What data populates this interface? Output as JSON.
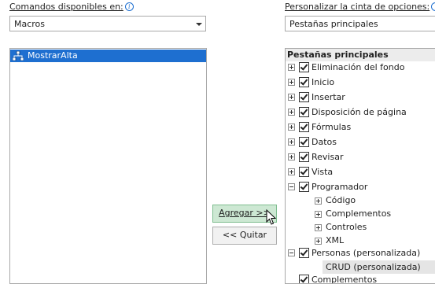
{
  "left": {
    "label": "Comandos disponibles en:",
    "dropdown_value": "Macros",
    "items": [
      {
        "label": "MostrarAlta",
        "selected": true,
        "icon": "macro-icon"
      }
    ]
  },
  "right": {
    "label": "Personalizar la cinta de opciones:",
    "dropdown_value": "Pestañas principales",
    "tree_header": "Pestañas principales",
    "tabs": [
      {
        "label": "Eliminación del fondo",
        "checked": true,
        "expanded": false
      },
      {
        "label": "Inicio",
        "checked": true,
        "expanded": false
      },
      {
        "label": "Insertar",
        "checked": true,
        "expanded": false
      },
      {
        "label": "Disposición de página",
        "checked": true,
        "expanded": false
      },
      {
        "label": "Fórmulas",
        "checked": true,
        "expanded": false
      },
      {
        "label": "Datos",
        "checked": true,
        "expanded": false
      },
      {
        "label": "Revisar",
        "checked": true,
        "expanded": false
      },
      {
        "label": "Vista",
        "checked": true,
        "expanded": false
      },
      {
        "label": "Programador",
        "checked": true,
        "expanded": true
      }
    ],
    "programador_groups": [
      "Código",
      "Complementos",
      "Controles",
      "XML"
    ],
    "personas": {
      "label": "Personas (personalizada)",
      "checked": true,
      "expanded": true
    },
    "crud": "CRUD (personalizada)",
    "complementos_bottom": {
      "label": "Complementos",
      "checked": true
    }
  },
  "buttons": {
    "add": "Agregar >>",
    "remove": "<< Quitar"
  },
  "colors": {
    "selection": "#1e6fd0",
    "add_hover": "#cde8d3",
    "crud_highlight": "#e5e5e5"
  }
}
